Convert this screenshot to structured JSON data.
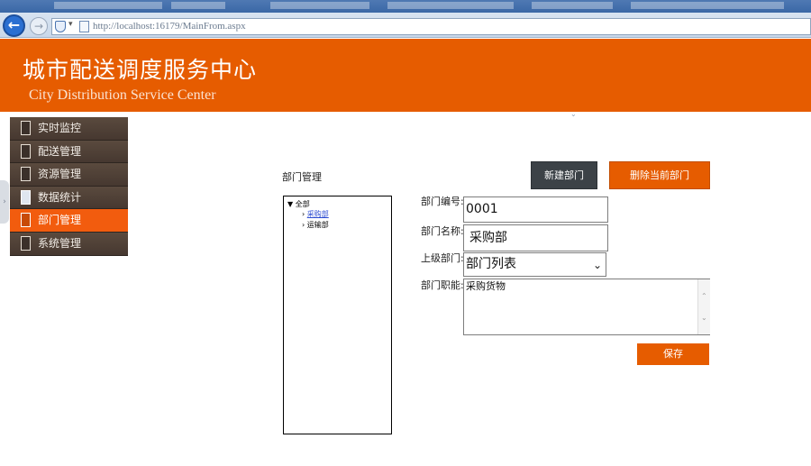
{
  "browser": {
    "url": "http://localhost:16179/MainFrom.aspx",
    "back_icon": "back-arrow-icon",
    "forward_icon": "forward-arrow-icon"
  },
  "header": {
    "title_cn": "城市配送调度服务中心",
    "title_en": "City Distribution Service Center"
  },
  "sidebar": {
    "items": [
      {
        "label": "实时监控",
        "icon": "monitor-icon"
      },
      {
        "label": "配送管理",
        "icon": "delivery-icon"
      },
      {
        "label": "资源管理",
        "icon": "resource-icon"
      },
      {
        "label": "数据统计",
        "icon": "statistics-icon"
      },
      {
        "label": "部门管理",
        "icon": "department-icon",
        "active": true
      },
      {
        "label": "系统管理",
        "icon": "system-icon"
      }
    ]
  },
  "main": {
    "section_title": "部门管理",
    "buttons": {
      "new_dept": "新建部门",
      "delete_dept": "删除当前部门",
      "save": "保存"
    },
    "tree": {
      "root": "全部",
      "children": [
        {
          "label": "采购部",
          "link": true
        },
        {
          "label": "运输部",
          "link": false
        }
      ]
    },
    "form": {
      "code_label": "部门编号:",
      "code_value": "0001",
      "name_label": "部门名称:",
      "name_value": "采购部",
      "parent_label": "上级部门:",
      "parent_value": "部门列表",
      "duty_label": "部门职能:",
      "duty_value": "采购货物"
    }
  },
  "colors": {
    "brand_orange": "#e65c00",
    "sidebar_bg": "#4e3f34",
    "active_item": "#f25c0e",
    "dark_button": "#3c4247"
  }
}
